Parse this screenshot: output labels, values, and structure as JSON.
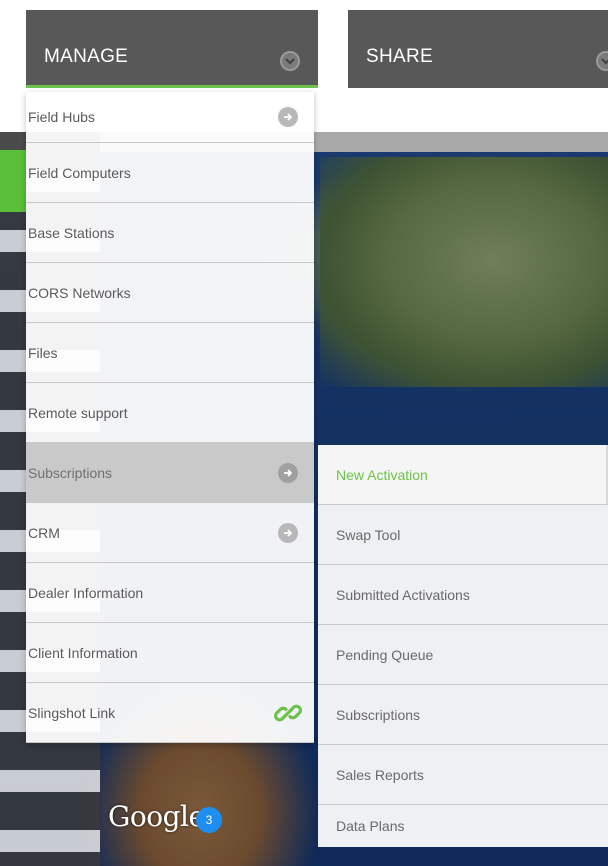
{
  "colors": {
    "accent": "#6cc24a",
    "topbar_bg": "#585858",
    "menu_text": "#5a5a5a",
    "active_bg": "#c9c9c9"
  },
  "topbar": {
    "manage_label": "MANAGE",
    "share_label": "SHARE",
    "manage_icon": "chevron-down-circle-icon",
    "share_icon": "chevron-down-circle-icon"
  },
  "manage_menu": {
    "items": [
      {
        "label": "Field Hubs",
        "icon": "arrow-right-circle-icon"
      },
      {
        "label": "Field Computers"
      },
      {
        "label": "Base Stations"
      },
      {
        "label": "CORS Networks"
      },
      {
        "label": "Files"
      },
      {
        "label": "Remote support"
      },
      {
        "label": "Subscriptions",
        "icon": "arrow-right-circle-icon",
        "active": true
      },
      {
        "label": "CRM",
        "icon": "arrow-right-circle-icon"
      },
      {
        "label": "Dealer Information"
      },
      {
        "label": "Client Information"
      },
      {
        "label": "Slingshot Link",
        "icon": "link-icon"
      }
    ]
  },
  "subscriptions_menu": {
    "items": [
      {
        "label": "New Activation",
        "selected": true
      },
      {
        "label": "Swap Tool"
      },
      {
        "label": "Submitted Activations"
      },
      {
        "label": "Pending Queue"
      },
      {
        "label": "Subscriptions"
      },
      {
        "label": "Sales Reports"
      },
      {
        "label": "Data Plans"
      }
    ]
  },
  "map": {
    "logo_text": "Google",
    "cluster_count": "3"
  }
}
